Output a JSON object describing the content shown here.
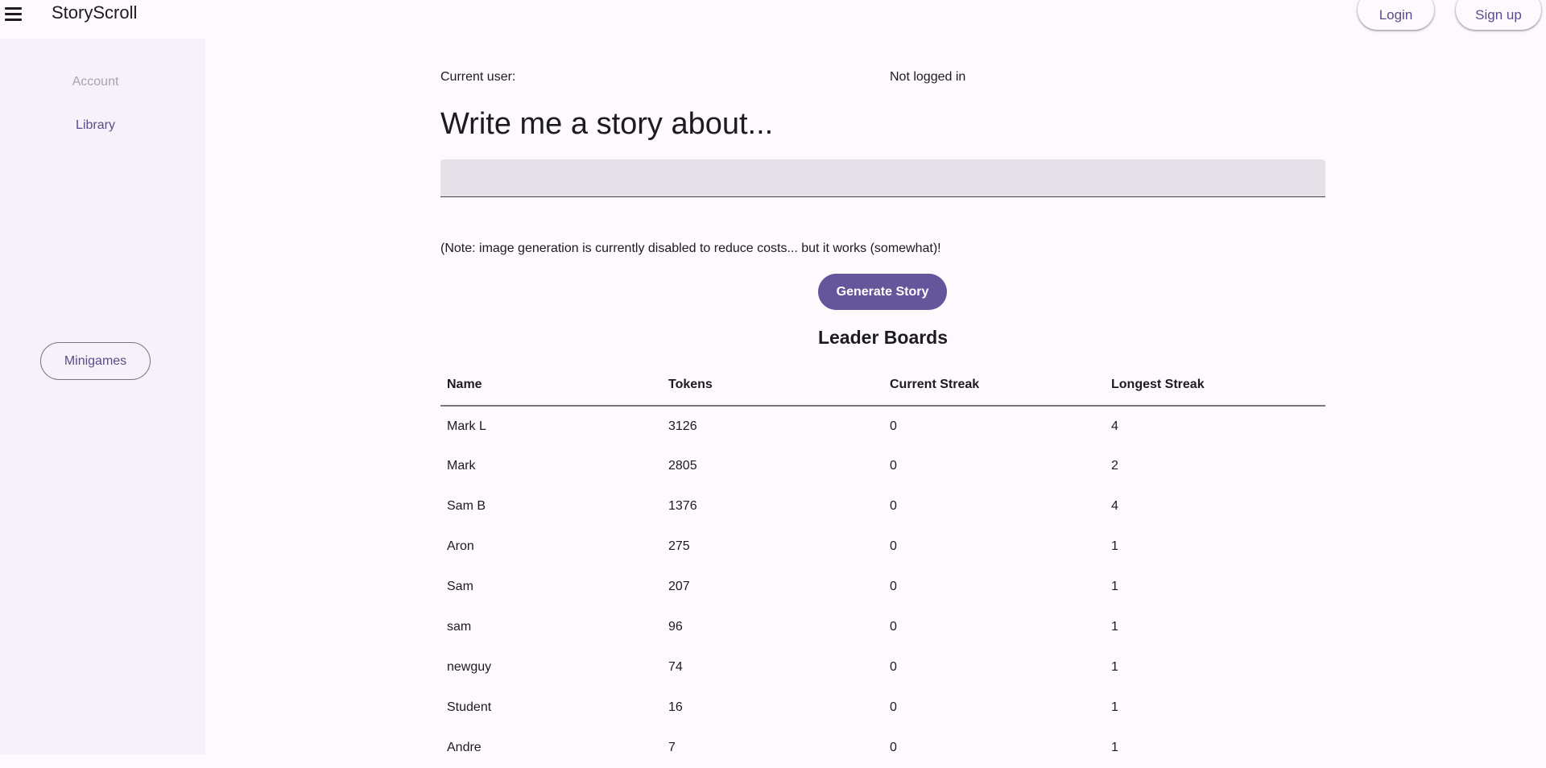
{
  "header": {
    "menu_icon": "hamburger-menu-icon",
    "title": "StoryScroll",
    "login_label": "Login",
    "signup_label": "Sign up"
  },
  "sidebar": {
    "account_label": "Account",
    "library_label": "Library",
    "minigames_label": "Minigames"
  },
  "main": {
    "current_user_label": "Current user:",
    "current_user_value": "Not logged in",
    "heading": "Write me a story about...",
    "input_value": "",
    "note": "(Note: image generation is currently disabled to reduce costs... but it works (somewhat)!",
    "generate_label": "Generate Story"
  },
  "leaderboard": {
    "title": "Leader Boards",
    "columns": [
      "Name",
      "Tokens",
      "Current Streak",
      "Longest Streak"
    ],
    "rows": [
      [
        "Mark L",
        "3126",
        "0",
        "4"
      ],
      [
        "Mark",
        "2805",
        "0",
        "2"
      ],
      [
        "Sam B",
        "1376",
        "0",
        "4"
      ],
      [
        "Aron",
        "275",
        "0",
        "1"
      ],
      [
        "Sam",
        "207",
        "0",
        "1"
      ],
      [
        "sam",
        "96",
        "0",
        "1"
      ],
      [
        "newguy",
        "74",
        "0",
        "1"
      ],
      [
        "Student",
        "16",
        "0",
        "1"
      ],
      [
        "Andre",
        "7",
        "0",
        "1"
      ]
    ]
  },
  "colors": {
    "accent": "#65559a",
    "accent_text": "#5b4b8a",
    "background": "#fdf9fd",
    "sidebar_bg": "#f6f2fa",
    "input_bg": "#e6e0e9"
  }
}
